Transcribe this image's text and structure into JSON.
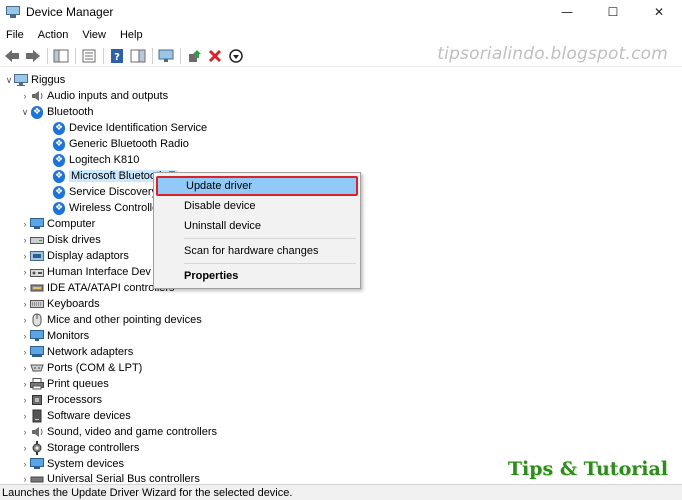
{
  "window": {
    "title": "Device Manager"
  },
  "menu": [
    "File",
    "Action",
    "View",
    "Help"
  ],
  "watermarks": {
    "top": "tipsorialindo.blogspot.com",
    "bottom": "Tips & Tutorial"
  },
  "tree": {
    "root": "Riggus",
    "nodes": [
      {
        "label": "Audio inputs and outputs",
        "icon": "speaker-icon",
        "expanded": false
      },
      {
        "label": "Bluetooth",
        "icon": "bluetooth-icon",
        "expanded": true,
        "children": [
          {
            "label": "Device Identification Service"
          },
          {
            "label": "Generic Bluetooth Radio"
          },
          {
            "label": "Logitech K810"
          },
          {
            "label": "Microsoft Bluetooth Enumerator",
            "display": "Microsoft Bluetooth E",
            "selected": true
          },
          {
            "label": "Service Discovery"
          },
          {
            "label": "Wireless Controller"
          }
        ]
      },
      {
        "label": "Computer",
        "icon": "computer-icon",
        "expanded": false
      },
      {
        "label": "Disk drives",
        "icon": "disk-drive-icon",
        "expanded": false
      },
      {
        "label": "Display adaptors",
        "icon": "display-adaptor-icon",
        "expanded": false
      },
      {
        "label": "Human Interface Dev",
        "icon": "hid-icon",
        "expanded": false
      },
      {
        "label": "IDE ATA/ATAPI controllers",
        "icon": "ide-controller-icon",
        "expanded": false
      },
      {
        "label": "Keyboards",
        "icon": "keyboard-icon",
        "expanded": false
      },
      {
        "label": "Mice and other pointing devices",
        "icon": "mouse-icon",
        "expanded": false
      },
      {
        "label": "Monitors",
        "icon": "monitor-icon",
        "expanded": false
      },
      {
        "label": "Network adapters",
        "icon": "network-adapter-icon",
        "expanded": false
      },
      {
        "label": "Ports (COM & LPT)",
        "icon": "port-icon",
        "expanded": false
      },
      {
        "label": "Print queues",
        "icon": "printer-icon",
        "expanded": false
      },
      {
        "label": "Processors",
        "icon": "processor-icon",
        "expanded": false
      },
      {
        "label": "Software devices",
        "icon": "software-device-icon",
        "expanded": false
      },
      {
        "label": "Sound, video and game controllers",
        "icon": "sound-icon",
        "expanded": false
      },
      {
        "label": "Storage controllers",
        "icon": "storage-controller-icon",
        "expanded": false
      },
      {
        "label": "System devices",
        "icon": "system-device-icon",
        "expanded": false
      },
      {
        "label": "Universal Serial Bus controllers",
        "icon": "usb-icon",
        "expanded": false
      }
    ]
  },
  "context_menu": {
    "update_driver": "Update driver",
    "disable_device": "Disable device",
    "uninstall_device": "Uninstall device",
    "scan": "Scan for hardware changes",
    "properties": "Properties"
  },
  "statusbar": {
    "text": "Launches the Update Driver Wizard for the selected device."
  },
  "colors": {
    "highlight": "#91c9f7",
    "highlight_border": "#d9222a",
    "bluetooth": "#1e73d6",
    "watermark_bottom": "#2e8b1e"
  }
}
